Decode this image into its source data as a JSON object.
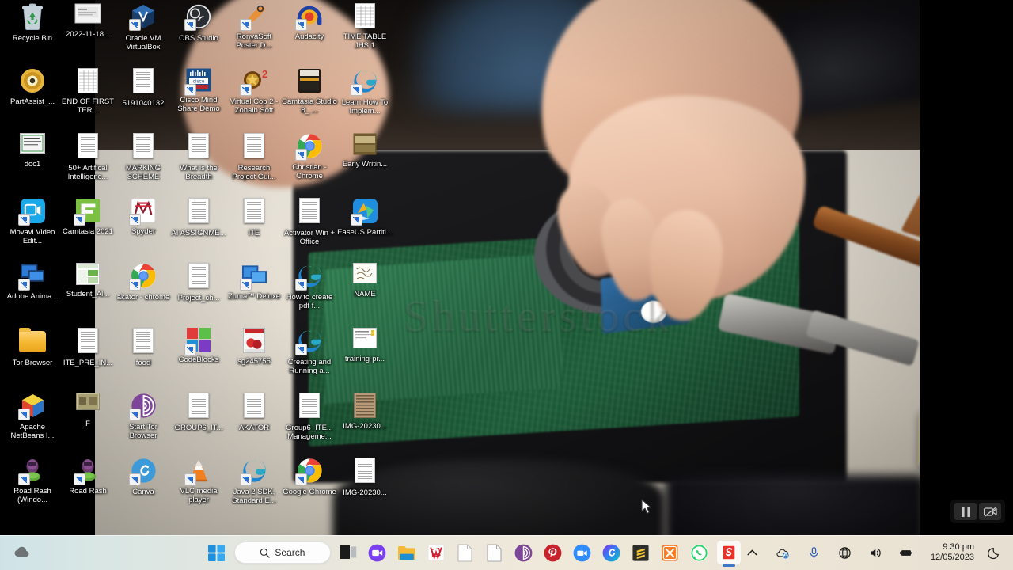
{
  "os": {
    "name": "Windows 11",
    "wallpaper_watermark": "Shutterstock"
  },
  "desktop": {
    "icons": [
      {
        "label": "Recycle Bin",
        "icon": "recycle-bin-icon",
        "col": 0,
        "row": 0,
        "type": "recycle"
      },
      {
        "label": "2022-11-18...",
        "icon": "image-file-icon",
        "col": 1,
        "row": 0,
        "type": "photo"
      },
      {
        "label": "Oracle VM VirtualBox",
        "icon": "virtualbox-icon",
        "col": 2,
        "row": 0,
        "type": "virtualbox"
      },
      {
        "label": "OBS Studio",
        "icon": "obs-studio-icon",
        "col": 3,
        "row": 0,
        "type": "obs"
      },
      {
        "label": "RonyaSoft Poster D...",
        "icon": "ronyasoft-icon",
        "col": 4,
        "row": 0,
        "type": "ronyasoft"
      },
      {
        "label": "Audacity",
        "icon": "audacity-icon",
        "col": 5,
        "row": 0,
        "type": "audacity"
      },
      {
        "label": "TIME TABLE JHS 1",
        "icon": "spreadsheet-icon",
        "col": 6,
        "row": 0,
        "type": "table"
      },
      {
        "label": "PartAssist_...",
        "icon": "disc-icon",
        "col": 0,
        "row": 1,
        "type": "disc"
      },
      {
        "label": "END OF FIRST TER...",
        "icon": "document-icon",
        "col": 1,
        "row": 1,
        "type": "table"
      },
      {
        "label": "5191040132",
        "icon": "document-icon",
        "col": 2,
        "row": 1,
        "type": "doc"
      },
      {
        "label": "Cisco Mind Share Demo",
        "icon": "cisco-icon",
        "col": 3,
        "row": 1,
        "type": "cisco"
      },
      {
        "label": "Virtual Cop 2 - Zohaib Soft",
        "icon": "virtualcop-icon",
        "col": 4,
        "row": 1,
        "type": "virtualcop"
      },
      {
        "label": "Camtasia Studio 8_ ...",
        "icon": "camtasia-archive-icon",
        "col": 5,
        "row": 1,
        "type": "camtasia8"
      },
      {
        "label": "Learn How To Implem...",
        "icon": "edge-icon",
        "col": 6,
        "row": 1,
        "type": "edge"
      },
      {
        "label": "doc1",
        "icon": "document-icon",
        "col": 0,
        "row": 2,
        "type": "doc1"
      },
      {
        "label": "50+ Artifical Intelligenc...",
        "icon": "pdf-icon",
        "col": 1,
        "row": 2,
        "type": "doc"
      },
      {
        "label": "MARKING SCHEME",
        "icon": "document-icon",
        "col": 2,
        "row": 2,
        "type": "doc"
      },
      {
        "label": "What is the Breadth",
        "icon": "document-icon",
        "col": 3,
        "row": 2,
        "type": "doc"
      },
      {
        "label": "Research Project Gui...",
        "icon": "document-icon",
        "col": 4,
        "row": 2,
        "type": "doc"
      },
      {
        "label": "Christian - Chrome",
        "icon": "chrome-icon",
        "col": 5,
        "row": 2,
        "type": "chrome"
      },
      {
        "label": "Early Writin...",
        "icon": "image-file-icon",
        "col": 6,
        "row": 2,
        "type": "photo2"
      },
      {
        "label": "Movavi Video Edit...",
        "icon": "movavi-icon",
        "col": 0,
        "row": 3,
        "type": "movavi"
      },
      {
        "label": "Camtasia 2021",
        "icon": "camtasia-icon",
        "col": 1,
        "row": 3,
        "type": "camtasia"
      },
      {
        "label": "Spyder",
        "icon": "spyder-icon",
        "col": 2,
        "row": 3,
        "type": "spyder"
      },
      {
        "label": "AI ASSIGNME...",
        "icon": "document-icon",
        "col": 3,
        "row": 3,
        "type": "doc"
      },
      {
        "label": "ITE",
        "icon": "document-icon",
        "col": 4,
        "row": 3,
        "type": "doc"
      },
      {
        "label": "Activator Win + Office",
        "icon": "document-icon",
        "col": 5,
        "row": 3,
        "type": "doc"
      },
      {
        "label": "EaseUS Partiti...",
        "icon": "easeus-icon",
        "col": 6,
        "row": 3,
        "type": "easeus"
      },
      {
        "label": "Adobe Anima...",
        "icon": "adobe-animate-icon",
        "col": 0,
        "row": 4,
        "type": "adobe"
      },
      {
        "label": "Student_Al...",
        "icon": "spreadsheet-icon",
        "col": 1,
        "row": 4,
        "type": "excel"
      },
      {
        "label": "akator - chrome",
        "icon": "chrome-icon",
        "col": 2,
        "row": 4,
        "type": "chrome"
      },
      {
        "label": "Project_ch...",
        "icon": "document-icon",
        "col": 3,
        "row": 4,
        "type": "doc"
      },
      {
        "label": "Zuma™ Deluxe",
        "icon": "zuma-icon",
        "col": 4,
        "row": 4,
        "type": "zuma"
      },
      {
        "label": "How to create pdf f...",
        "icon": "edge-icon",
        "col": 5,
        "row": 4,
        "type": "edge"
      },
      {
        "label": "NAME",
        "icon": "image-file-icon",
        "col": 6,
        "row": 4,
        "type": "note"
      },
      {
        "label": "Tor Browser",
        "icon": "folder-icon",
        "col": 0,
        "row": 5,
        "type": "folder"
      },
      {
        "label": "ITE_PRE_IN...",
        "icon": "document-icon",
        "col": 1,
        "row": 5,
        "type": "doc"
      },
      {
        "label": "food",
        "icon": "document-icon",
        "col": 2,
        "row": 5,
        "type": "doc"
      },
      {
        "label": "CodeBlocks",
        "icon": "codeblocks-icon",
        "col": 3,
        "row": 5,
        "type": "codeblocks"
      },
      {
        "label": "sg245755",
        "icon": "pdf-icon",
        "col": 4,
        "row": 5,
        "type": "redbook"
      },
      {
        "label": "Creating and Running a...",
        "icon": "edge-icon",
        "col": 5,
        "row": 5,
        "type": "edge"
      },
      {
        "label": "training-pr...",
        "icon": "document-icon",
        "col": 6,
        "row": 5,
        "type": "cert"
      },
      {
        "label": "Apache NetBeans I...",
        "icon": "netbeans-icon",
        "col": 0,
        "row": 6,
        "type": "netbeans"
      },
      {
        "label": "F",
        "icon": "image-file-icon",
        "col": 1,
        "row": 6,
        "type": "photo3"
      },
      {
        "label": "Start Tor Browser",
        "icon": "tor-icon",
        "col": 2,
        "row": 6,
        "type": "tor"
      },
      {
        "label": "GROUP6_IT...",
        "icon": "document-icon",
        "col": 3,
        "row": 6,
        "type": "doc"
      },
      {
        "label": "AKATOR",
        "icon": "document-icon",
        "col": 4,
        "row": 6,
        "type": "doc"
      },
      {
        "label": "Group6_ITE... Manageme...",
        "icon": "document-icon",
        "col": 5,
        "row": 6,
        "type": "doc"
      },
      {
        "label": "IMG-20230...",
        "icon": "image-file-icon",
        "col": 6,
        "row": 6,
        "type": "photo4"
      },
      {
        "label": "Road Rash (Windo...",
        "icon": "road-rash-icon",
        "col": 0,
        "row": 7,
        "type": "roadrash"
      },
      {
        "label": "Road Rash",
        "icon": "road-rash-icon",
        "col": 1,
        "row": 7,
        "type": "roadrash"
      },
      {
        "label": "Canva",
        "icon": "canva-icon",
        "col": 2,
        "row": 7,
        "type": "canva"
      },
      {
        "label": "VLC media player",
        "icon": "vlc-icon",
        "col": 3,
        "row": 7,
        "type": "vlc"
      },
      {
        "label": "Java 2 SDK, Standard E...",
        "icon": "edge-icon",
        "col": 4,
        "row": 7,
        "type": "edge"
      },
      {
        "label": "Google Ghrome",
        "icon": "chrome-icon",
        "col": 5,
        "row": 7,
        "type": "chrome"
      },
      {
        "label": "IMG-20230...",
        "icon": "image-file-icon",
        "col": 6,
        "row": 7,
        "type": "photo5"
      }
    ]
  },
  "recording_overlay": {
    "buttons": [
      {
        "name": "pause-recording-button",
        "icon": "pause-icon"
      },
      {
        "name": "toggle-camera-button",
        "icon": "camera-off-icon"
      }
    ]
  },
  "taskbar": {
    "weather_widget": {
      "icon": "weather-cloud-icon"
    },
    "start_label": "Start",
    "search": {
      "placeholder": "Search",
      "icon": "search-icon"
    },
    "pinned": [
      {
        "name": "task-view-button",
        "icon": "task-view-icon",
        "label": "Task View",
        "running": false
      },
      {
        "name": "taskbar-app-whatsapp-meet",
        "icon": "chat-video-icon",
        "label": "Meet",
        "running": false
      },
      {
        "name": "taskbar-app-file-explorer",
        "icon": "file-explorer-icon",
        "label": "File Explorer",
        "running": false
      },
      {
        "name": "taskbar-app-kingsoft",
        "icon": "wps-icon",
        "label": "WPS Office",
        "running": false
      },
      {
        "name": "taskbar-app-notepad",
        "icon": "notepad-icon",
        "label": "Notepad",
        "running": false
      },
      {
        "name": "taskbar-app-document",
        "icon": "document-icon",
        "label": "Document",
        "running": false
      },
      {
        "name": "taskbar-app-tor",
        "icon": "tor-icon",
        "label": "Tor Browser",
        "running": false
      },
      {
        "name": "taskbar-app-pinterest",
        "icon": "pinterest-icon",
        "label": "Pinterest",
        "running": false
      },
      {
        "name": "taskbar-app-zoom",
        "icon": "zoom-icon",
        "label": "Zoom",
        "running": false
      },
      {
        "name": "taskbar-app-canva",
        "icon": "canva-icon",
        "label": "Canva",
        "running": false
      },
      {
        "name": "taskbar-app-sublime",
        "icon": "sublime-text-icon",
        "label": "Sublime Text",
        "running": false
      },
      {
        "name": "taskbar-app-xampp",
        "icon": "xampp-icon",
        "label": "XAMPP",
        "running": false
      },
      {
        "name": "taskbar-app-whatsapp",
        "icon": "whatsapp-icon",
        "label": "WhatsApp",
        "running": false
      },
      {
        "name": "taskbar-app-snagit",
        "icon": "snagit-icon",
        "label": "Snagit",
        "running": true
      }
    ],
    "tray": {
      "overflow_icon": "chevron-up-icon",
      "items": [
        {
          "name": "tray-onedrive",
          "icon": "onedrive-icon"
        },
        {
          "name": "tray-microphone",
          "icon": "microphone-icon"
        },
        {
          "name": "tray-network",
          "icon": "globe-network-icon"
        },
        {
          "name": "tray-volume",
          "icon": "speaker-icon"
        },
        {
          "name": "tray-battery",
          "icon": "battery-charging-icon"
        }
      ],
      "clock": {
        "time": "9:30 pm",
        "date": "12/05/2023"
      },
      "notification_icon": "moon-do-not-disturb-icon"
    }
  },
  "colors": {
    "accent": "#3b78cc",
    "taskbar_bg": "#e8e5da",
    "icon_label": "#ffffff"
  }
}
